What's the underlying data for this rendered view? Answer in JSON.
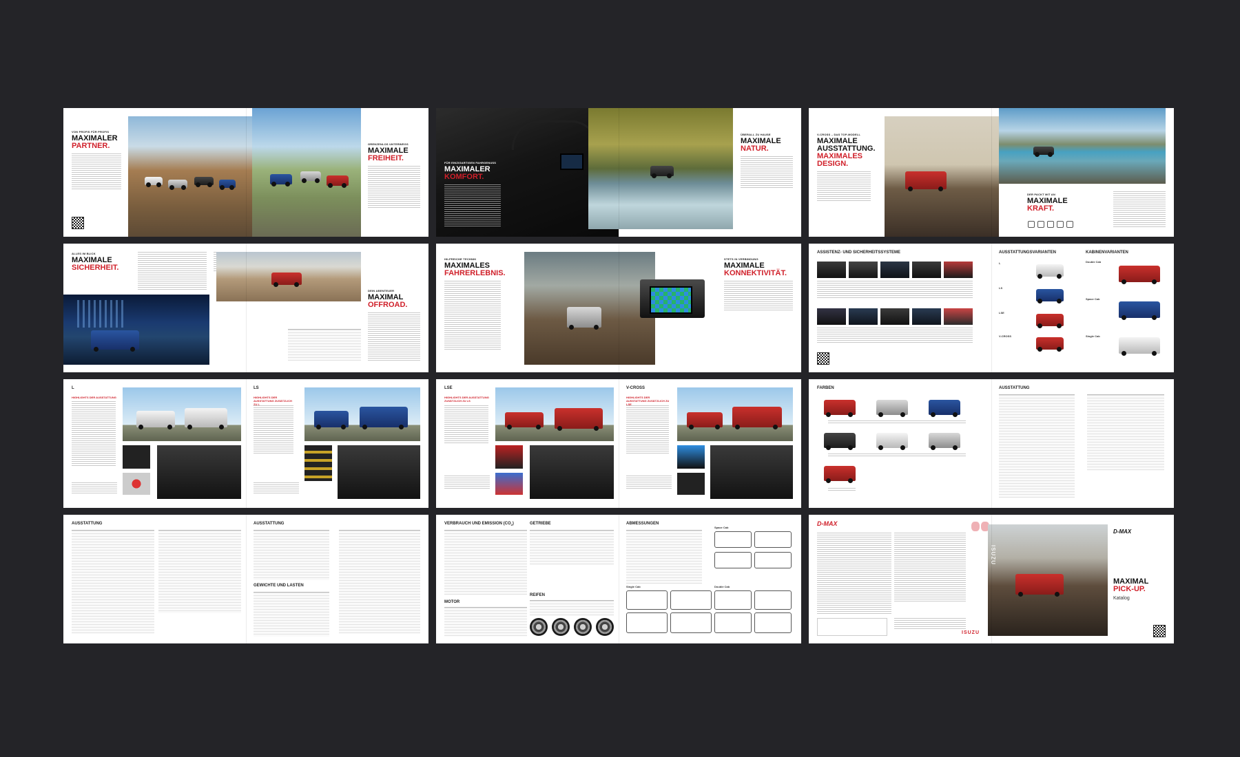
{
  "s1": {
    "p1_kicker": "VON PROFIS FÜR PROFIS",
    "p1_h1": "MAXIMALER",
    "p1_h2": "PARTNER.",
    "p2_kicker": "GRENZENLOS UNTERWEGS",
    "p2_h1": "MAXIMALE",
    "p2_h2": "FREIHEIT."
  },
  "s2": {
    "p1_kicker": "FÜR EINZIGARTIGEN FAHRGENUSS",
    "p1_h1": "MAXIMALER",
    "p1_h2": "KOMFORT.",
    "p2_kicker": "ÜBERALL ZU HAUSE",
    "p2_h1": "MAXIMALE",
    "p2_h2": "NATUR."
  },
  "s3": {
    "p1_kicker": "V-CROSS – DAS TOP-MODELL",
    "p1_h1a": "MAXIMALE",
    "p1_h1b": "AUSSTATTUNG.",
    "p1_h2a": "MAXIMALES",
    "p1_h2b": "DESIGN.",
    "p2_kicker": "DER PACKT MIT AN",
    "p2_h1": "MAXIMALE",
    "p2_h2": "KRAFT."
  },
  "s4": {
    "p1_kicker": "ALLES IM BLICK",
    "p1_h1": "MAXIMALE",
    "p1_h2": "SICHERHEIT.",
    "p2_kicker": "DEIN ABENTEUER",
    "p2_h1": "MAXIMAL",
    "p2_h2": "OFFROAD."
  },
  "s5": {
    "p1_kicker": "HILFREICHE TECHNIK",
    "p1_h1": "MAXIMALES",
    "p1_h2": "FAHRERLEBNIS.",
    "p2_kicker": "STETS IN VERBINDUNG",
    "p2_h1": "MAXIMALE",
    "p2_h2": "KONNEKTIVITÄT."
  },
  "s6": {
    "sec1": "ASSISTENZ- UND SICHERHEITSSYSTEME",
    "sec2": "AUSSTATTUNGSVARIANTEN",
    "sec3": "KABINENVARIANTEN",
    "variants": [
      "L",
      "LS",
      "LSE",
      "V-CROSS"
    ],
    "cabins": [
      "Double Cab",
      "Space Cab",
      "Single Cab"
    ]
  },
  "s7": {
    "p1_sec": "L",
    "p1_red": "HIGHLIGHTS DER AUSSTATTUNG",
    "p2_sec": "LS",
    "p2_red": "HIGHLIGHTS DER AUSSTATTUNG ZUSÄTZLICH ZU L"
  },
  "s8": {
    "p1_sec": "LSE",
    "p1_red": "HIGHLIGHTS DER AUSSTATTUNG ZUSÄTZLICH ZU LS",
    "p2_sec": "V-CROSS",
    "p2_red": "HIGHLIGHTS DER AUSSTATTUNG ZUSÄTZLICH ZU LSE"
  },
  "s9": {
    "sec1": "FARBEN",
    "sec2": "AUSSTATTUNG"
  },
  "s10": {
    "sec1": "AUSSTATTUNG",
    "sec2": "AUSSTATTUNG",
    "sec3": "GEWICHTE UND LASTEN"
  },
  "s11": {
    "sec1": "VERBRAUCH UND EMISSION (CO",
    "sec1_sub": "2",
    "sec1_end": ")",
    "sec2": "GETRIEBE",
    "sec3": "MOTOR",
    "sec4": "REIFEN",
    "sec5": "ABMESSUNGEN",
    "dim_labels": [
      "Space Cab",
      "Single Cab",
      "Double Cab"
    ]
  },
  "s12": {
    "logo": "D-MAX",
    "brand": "ISUZU",
    "cover_logo": "D-MAX",
    "cover_h1": "MAXIMAL",
    "cover_h2": "PICK-UP.",
    "cover_sub": "Katalog"
  }
}
